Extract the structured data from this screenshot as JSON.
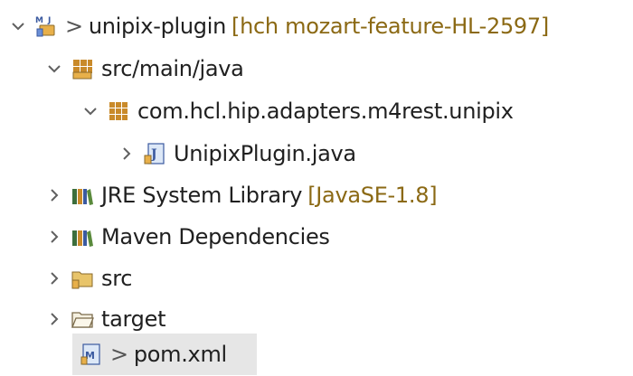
{
  "tree": {
    "project": {
      "prefix": ">",
      "name": "unipix-plugin",
      "decoration": "[hch mozart-feature-HL-2597]"
    },
    "source_folder": {
      "name": "src/main/java"
    },
    "package": {
      "name": "com.hcl.hip.adapters.m4rest.unipix"
    },
    "java_file": {
      "name": "UnipixPlugin.java"
    },
    "jre_library": {
      "name": "JRE System Library",
      "decoration": "[JavaSE-1.8]"
    },
    "maven_deps": {
      "name": "Maven Dependencies"
    },
    "src_folder": {
      "name": "src"
    },
    "target_folder": {
      "name": "target"
    },
    "pom": {
      "prefix": ">",
      "name": "pom.xml"
    }
  },
  "colors": {
    "decoration": "#8b6914",
    "text": "#202020",
    "chevron": "#606060"
  }
}
